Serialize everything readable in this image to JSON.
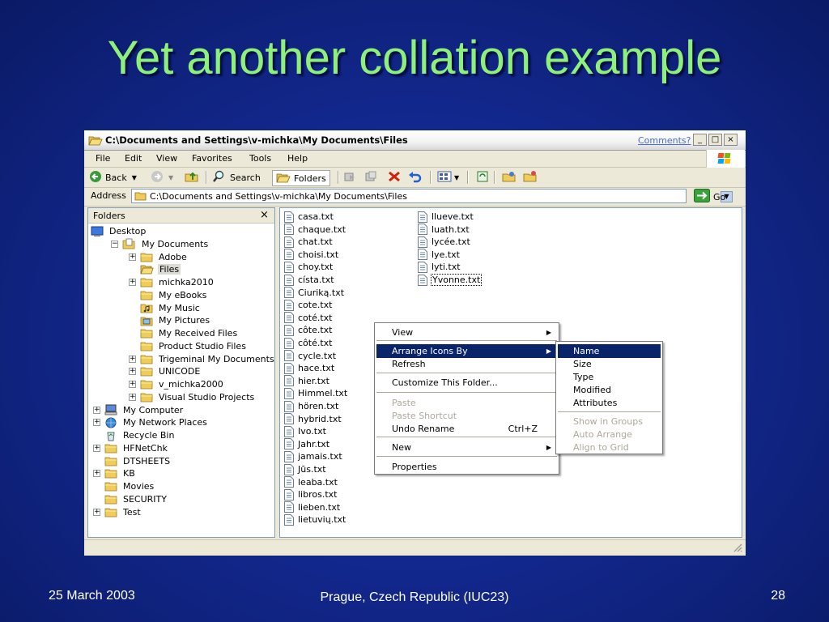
{
  "slide": {
    "title": "Yet another collation example",
    "footer_date": "25 March 2003",
    "footer_place": "Prague, Czech Republic (IUC23)",
    "footer_page": "28"
  },
  "window": {
    "title": "C:\\Documents and Settings\\v-michka\\My Documents\\Files",
    "comments_link": "Comments?",
    "min": "_",
    "max": "□",
    "close": "×"
  },
  "menubar": [
    "File",
    "Edit",
    "View",
    "Favorites",
    "Tools",
    "Help"
  ],
  "toolbar": {
    "back": "Back",
    "search": "Search",
    "folders": "Folders"
  },
  "address": {
    "label": "Address",
    "value": "C:\\Documents and Settings\\v-michka\\My Documents\\Files",
    "go": "Go"
  },
  "folders_pane": {
    "header": "Folders",
    "close": "×",
    "tree": [
      {
        "label": "Desktop",
        "expander": "",
        "icon": "desktop-icon"
      },
      {
        "label": "My Documents",
        "expander": "−",
        "icon": "my-documents-icon"
      },
      {
        "label": "Adobe",
        "expander": "+",
        "icon": "folder-icon"
      },
      {
        "label": "Files",
        "expander": "",
        "icon": "folder-open-icon",
        "selected": true
      },
      {
        "label": "michka2010",
        "expander": "+",
        "icon": "folder-icon"
      },
      {
        "label": "My eBooks",
        "expander": "",
        "icon": "folder-icon"
      },
      {
        "label": "My Music",
        "expander": "",
        "icon": "music-folder-icon"
      },
      {
        "label": "My Pictures",
        "expander": "",
        "icon": "pictures-folder-icon"
      },
      {
        "label": "My Received Files",
        "expander": "",
        "icon": "folder-icon"
      },
      {
        "label": "Product Studio Files",
        "expander": "",
        "icon": "folder-icon"
      },
      {
        "label": "Trigeminal My Documents",
        "expander": "+",
        "icon": "folder-icon"
      },
      {
        "label": "UNICODE",
        "expander": "+",
        "icon": "folder-icon"
      },
      {
        "label": "v_michka2000",
        "expander": "+",
        "icon": "folder-icon"
      },
      {
        "label": "Visual Studio Projects",
        "expander": "+",
        "icon": "folder-icon"
      },
      {
        "label": "My Computer",
        "expander": "+",
        "icon": "computer-icon"
      },
      {
        "label": "My Network Places",
        "expander": "+",
        "icon": "network-icon"
      },
      {
        "label": "Recycle Bin",
        "expander": "",
        "icon": "recycle-bin-icon"
      },
      {
        "label": "HFNetChk",
        "expander": "+",
        "icon": "folder-icon"
      },
      {
        "label": "DTSHEETS",
        "expander": "",
        "icon": "folder-icon"
      },
      {
        "label": "KB",
        "expander": "+",
        "icon": "folder-icon"
      },
      {
        "label": "Movies",
        "expander": "",
        "icon": "folder-icon"
      },
      {
        "label": "SECURITY",
        "expander": "",
        "icon": "folder-icon"
      },
      {
        "label": "Test",
        "expander": "+",
        "icon": "folder-icon"
      }
    ]
  },
  "files": {
    "col1": [
      "casa.txt",
      "chaque.txt",
      "chat.txt",
      "choisi.txt",
      "choy.txt",
      "císta.txt",
      "Ciuriką.txt",
      "cote.txt",
      "coté.txt",
      "côte.txt",
      "côté.txt",
      "cycle.txt",
      "hace.txt",
      "hier.txt",
      "Himmel.txt",
      "hören.txt",
      "hybrid.txt",
      "Ivo.txt",
      "Jahr.txt",
      "jamais.txt",
      "Jūs.txt",
      "leaba.txt",
      "libros.txt",
      "lieben.txt",
      "lietuvių.txt"
    ],
    "col2": [
      "llueve.txt",
      "luath.txt",
      "lycée.txt",
      "lye.txt",
      "lyti.txt",
      "Yvonne.txt"
    ]
  },
  "context_menu": {
    "items": [
      {
        "label": "View",
        "submenu": true
      },
      {
        "label": "Arrange Icons By",
        "submenu": true,
        "highlighted": true
      },
      {
        "label": "Refresh"
      },
      {
        "label": "Customize This Folder..."
      },
      {
        "label": "Paste",
        "disabled": true
      },
      {
        "label": "Paste Shortcut",
        "disabled": true
      },
      {
        "label": "Undo Rename",
        "shortcut": "Ctrl+Z"
      },
      {
        "label": "New",
        "submenu": true
      },
      {
        "label": "Properties"
      }
    ]
  },
  "submenu": {
    "items": [
      {
        "label": "Name",
        "highlighted": true
      },
      {
        "label": "Size"
      },
      {
        "label": "Type"
      },
      {
        "label": "Modified"
      },
      {
        "label": "Attributes"
      },
      {
        "label": "Show in Groups",
        "disabled": true
      },
      {
        "label": "Auto Arrange",
        "disabled": true
      },
      {
        "label": "Align to Grid",
        "disabled": true
      }
    ]
  }
}
